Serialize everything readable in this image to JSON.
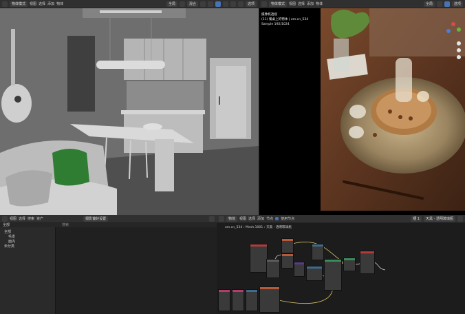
{
  "viewport_left": {
    "mode": "物体模式",
    "menus": [
      "视图",
      "选择",
      "添加",
      "物体"
    ],
    "transform": "全局",
    "blend": "混合",
    "options": "选项"
  },
  "viewport_right": {
    "mode": "物体模式",
    "menus": [
      "视图",
      "选择",
      "添加",
      "物体"
    ],
    "transform": "全局",
    "options": "选项",
    "render_info": {
      "line1": "摄像机透视",
      "line2": "(11) 餐桌上的物体 | om.cn_534",
      "line3": "Sample 192/1024"
    }
  },
  "outliner": {
    "editor_menus": [
      "视图",
      "选择",
      "搜索",
      "资产"
    ],
    "filter_value": "全部",
    "search_placeholder": "搜索",
    "prop_dropdown": "摄影偏好设置",
    "items": [
      "全部",
      "毛发",
      "面内",
      "未分类"
    ]
  },
  "node_editor": {
    "menus": [
      "视图",
      "选择",
      "添加",
      "节点"
    ],
    "use_nodes_label": "使用节点",
    "object_type": "物体",
    "slot": "槽 1",
    "material_name": "天黑 - 透明玻璃瓶",
    "breadcrumb": [
      "om.cn_534",
      "Mesh.1001",
      "天黑 - 透明玻璃瓶"
    ]
  },
  "colors": {
    "header_bg": "#303030",
    "panel_bg": "#2a2a2a",
    "node_bg": "#1c1c1c",
    "accent": "#4772b3"
  }
}
